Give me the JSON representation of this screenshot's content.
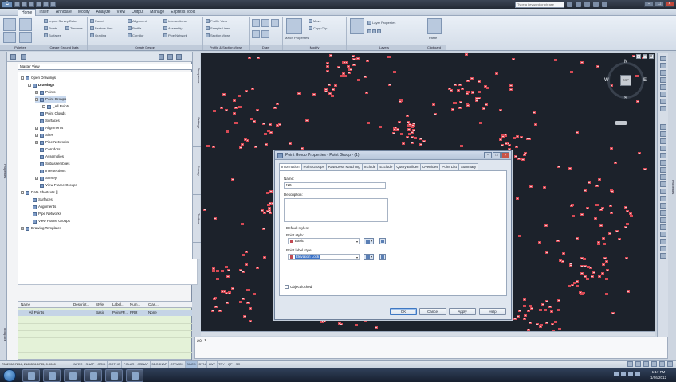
{
  "titlebar": {
    "help_search_placeholder": "Type a keyword or phrase",
    "logo": "C"
  },
  "ribbon": {
    "tabs": [
      "Home",
      "Insert",
      "Annotate",
      "Modify",
      "Analyze",
      "View",
      "Output",
      "Manage",
      "Express Tools"
    ],
    "active_tab": "Home",
    "panels": [
      "Palettes",
      "Create Ground Data",
      "Create Design",
      "Profile & Section Views",
      "Draw",
      "Modify",
      "Layers",
      "Clipboard"
    ],
    "buttons": {
      "import_survey_data": "Import Survey Data",
      "points": "Points",
      "surfaces": "Surfaces",
      "traverse": "Traverse",
      "feature_line": "Feature Line",
      "grading": "Grading",
      "parcel": "Parcel",
      "alignment": "Alignment",
      "profile": "Profile",
      "corridor": "Corridor",
      "intersections": "Intersections",
      "assembly": "Assembly",
      "pipe_network": "Pipe Network",
      "profile_view": "Profile View",
      "sample_lines": "Sample Lines",
      "section_views": "Section Views",
      "move": "Move",
      "copy_clip": "Copy Clip",
      "paste": "Paste",
      "layer_props": "Layer Properties",
      "match_props": "Match Properties"
    }
  },
  "prospector": {
    "view_select": "Master View",
    "tree": [
      {
        "label": "Open Drawings",
        "depth": 0,
        "expander": "-"
      },
      {
        "label": "Drawing2",
        "depth": 1,
        "expander": "-",
        "bold": true
      },
      {
        "label": "Points",
        "depth": 2,
        "expander": "+"
      },
      {
        "label": "Point Groups",
        "depth": 2,
        "expander": "-",
        "selected": true
      },
      {
        "label": "_All Points",
        "depth": 3,
        "expander": "+"
      },
      {
        "label": "Point Clouds",
        "depth": 2,
        "expander": ""
      },
      {
        "label": "Surfaces",
        "depth": 2,
        "expander": ""
      },
      {
        "label": "Alignments",
        "depth": 2,
        "expander": "+"
      },
      {
        "label": "Sites",
        "depth": 2,
        "expander": "+"
      },
      {
        "label": "Pipe Networks",
        "depth": 2,
        "expander": "+"
      },
      {
        "label": "Corridors",
        "depth": 2,
        "expander": ""
      },
      {
        "label": "Assemblies",
        "depth": 2,
        "expander": ""
      },
      {
        "label": "Subassemblies",
        "depth": 2,
        "expander": ""
      },
      {
        "label": "Intersections",
        "depth": 2,
        "expander": ""
      },
      {
        "label": "Survey",
        "depth": 2,
        "expander": "+"
      },
      {
        "label": "View Frame Groups",
        "depth": 2,
        "expander": ""
      },
      {
        "label": "Data Shortcuts []",
        "depth": 0,
        "expander": "-"
      },
      {
        "label": "Surfaces",
        "depth": 1,
        "expander": ""
      },
      {
        "label": "Alignments",
        "depth": 1,
        "expander": ""
      },
      {
        "label": "Pipe Networks",
        "depth": 1,
        "expander": ""
      },
      {
        "label": "View Frame Groups",
        "depth": 1,
        "expander": ""
      },
      {
        "label": "Drawing Templates",
        "depth": 0,
        "expander": "+"
      }
    ],
    "side_tabs": [
      "Prospector",
      "Settings",
      "Survey",
      "Toolbox"
    ],
    "left_strip_tabs": [
      "Properties",
      "Toolspace"
    ]
  },
  "listview": {
    "columns": [
      "Name",
      "Descript...",
      "Style",
      "Label...",
      "Num...",
      "Clas..."
    ],
    "rows": [
      {
        "name": "_All Points",
        "desc": "",
        "style": "Basic",
        "label": "Point#P...",
        "num": "PRR",
        "class": "None"
      }
    ]
  },
  "drawing": {
    "viewcube": {
      "top": "TOP",
      "n": "N",
      "s": "S",
      "e": "E",
      "w": "W"
    },
    "win_buttons": [
      "-",
      "□",
      "×"
    ]
  },
  "command_line": {
    "text": "20 *"
  },
  "statusbar": {
    "coords": "7362108.7254, 2164526.6785, 0.0000",
    "toggles": [
      {
        "label": "INFER",
        "on": false
      },
      {
        "label": "SNAP",
        "on": false
      },
      {
        "label": "GRID",
        "on": false
      },
      {
        "label": "ORTHO",
        "on": false
      },
      {
        "label": "POLAR",
        "on": false
      },
      {
        "label": "OSNAP",
        "on": false
      },
      {
        "label": "3DOSNAP",
        "on": false
      },
      {
        "label": "OTRACK",
        "on": false
      },
      {
        "label": "DUCS",
        "on": true
      },
      {
        "label": "DYN",
        "on": false
      },
      {
        "label": "LWT",
        "on": false
      },
      {
        "label": "TPY",
        "on": false
      },
      {
        "label": "QP",
        "on": false
      },
      {
        "label": "SC",
        "on": false
      }
    ]
  },
  "taskbar": {
    "time": "1:17 PM",
    "date": "1/26/2012"
  },
  "dialog": {
    "title": "Point Group Properties - Point Group - (1)",
    "tabs": [
      "Information",
      "Point Groups",
      "Raw Desc Matching",
      "Include",
      "Exclude",
      "Query Builder",
      "Overrides",
      "Point List",
      "Summary"
    ],
    "active_tab": "Information",
    "name_label": "Name:",
    "name_value": "NG",
    "description_label": "Description:",
    "description_value": "",
    "default_styles_label": "Default styles:",
    "point_style_label": "Point style:",
    "point_style_value": "Basic",
    "point_label_style_label": "Point label style:",
    "point_label_style_value": "Elevation Lock",
    "object_locked_label": "Object locked",
    "buttons": {
      "ok": "OK",
      "cancel": "Cancel",
      "apply": "Apply",
      "help": "Help"
    }
  },
  "colors": {
    "drawing_background": "#1c222b",
    "point_marker": "#d64a55",
    "selection": "#3d73c6"
  }
}
